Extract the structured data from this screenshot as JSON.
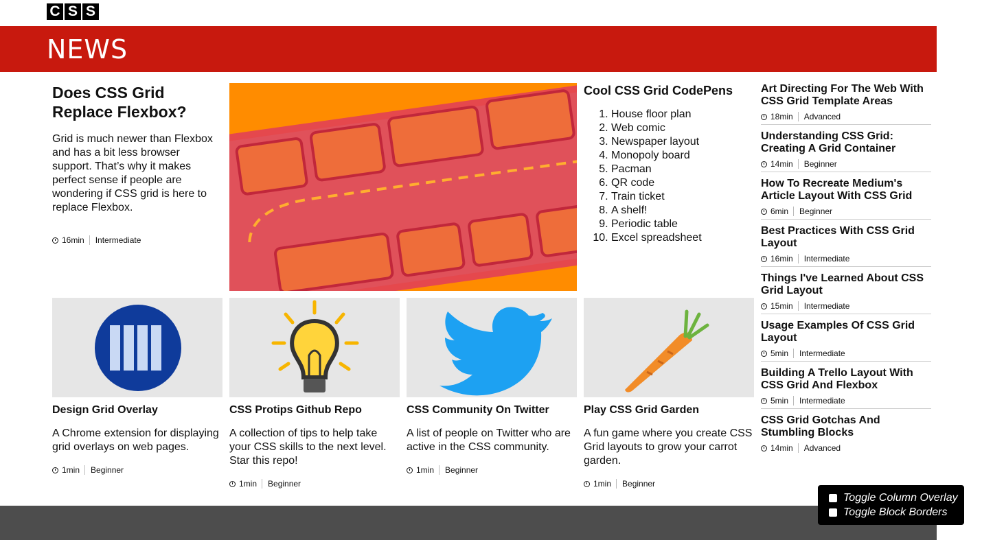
{
  "logo": {
    "letters": [
      "C",
      "S",
      "S"
    ]
  },
  "banner": {
    "title": "NEWS"
  },
  "lead": {
    "title": "Does CSS Grid Replace Flexbox?",
    "body": "Grid is much newer than Flexbox and has a bit less browser support. That’s why it makes perfect sense if people are wondering if CSS grid is here to replace Flexbox.",
    "duration": "16min",
    "level": "Intermediate"
  },
  "pens": {
    "title": "Cool CSS Grid CodePens",
    "items": [
      "House floor plan",
      "Web comic",
      "Newspaper layout",
      "Monopoly board",
      "Pacman",
      "QR code",
      "Train ticket",
      "A shelf!",
      "Periodic table",
      "Excel spreadsheet"
    ]
  },
  "side": [
    {
      "title": "Art Directing For The Web With CSS Grid Template Areas",
      "duration": "18min",
      "level": "Advanced"
    },
    {
      "title": "Understanding CSS Grid: Creating A Grid Container",
      "duration": "14min",
      "level": "Beginner"
    },
    {
      "title": "How To Recreate Medium's Article Layout With CSS Grid",
      "duration": "6min",
      "level": "Beginner"
    },
    {
      "title": "Best Practices With CSS Grid Layout",
      "duration": "16min",
      "level": "Intermediate"
    },
    {
      "title": "Things I've Learned About CSS Grid Layout",
      "duration": "15min",
      "level": "Intermediate"
    },
    {
      "title": "Usage Examples Of CSS Grid Layout",
      "duration": "5min",
      "level": "Intermediate"
    },
    {
      "title": "Building A Trello Layout With CSS Grid And Flexbox",
      "duration": "5min",
      "level": "Intermediate"
    },
    {
      "title": "CSS Grid Gotchas And Stumbling Blocks",
      "duration": "14min",
      "level": "Advanced"
    }
  ],
  "cards": [
    {
      "title": "Design Grid Overlay",
      "body": "A Chrome extension for displaying grid overlays on web pages.",
      "duration": "1min",
      "level": "Beginner"
    },
    {
      "title": "CSS Protips Github Repo",
      "body": "A collection of tips to help take your CSS skills to the next level. Star this repo!",
      "duration": "1min",
      "level": "Beginner"
    },
    {
      "title": "CSS Community On Twitter",
      "body": "A list of people on Twitter who are active in the CSS community.",
      "duration": "1min",
      "level": "Beginner"
    },
    {
      "title": "Play CSS Grid Garden",
      "body": "A fun game where you create CSS Grid layouts to grow your carrot garden.",
      "duration": "1min",
      "level": "Beginner"
    }
  ],
  "toggles": {
    "column_overlay": "Toggle Column Overlay",
    "block_borders": "Toggle Block Borders"
  },
  "colors": {
    "banner": "#c8190e",
    "footer": "#4d4d4d",
    "hero_bg": "#ff8c00",
    "twitter": "#1da1f2",
    "grid_overlay": "#0f3b9b"
  }
}
